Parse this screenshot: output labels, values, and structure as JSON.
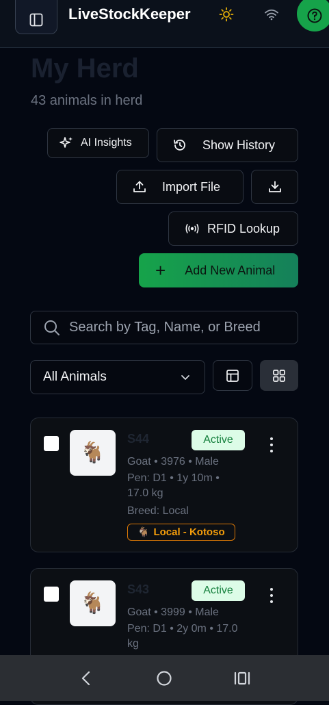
{
  "header": {
    "app_title": "LiveStockKeeper",
    "icons": [
      "sidebar-toggle-icon",
      "sun-icon",
      "wifi-icon",
      "help-icon"
    ]
  },
  "page": {
    "title": "My Herd",
    "subtitle": "43 animals in herd"
  },
  "actions": {
    "ai_insights": "AI Insights",
    "show_history": "Show History",
    "import_file": "Import File",
    "rfid_lookup": "RFID Lookup",
    "add_new_animal": "Add New Animal"
  },
  "search": {
    "placeholder": "Search by Tag, Name, or Breed"
  },
  "filter": {
    "selected": "All Animals"
  },
  "colors": {
    "accent_green": "#16a34a",
    "status_active_bg": "#dcfce7",
    "status_active_text": "#15803d",
    "breed_badge": "#f59e0b"
  },
  "animals": [
    {
      "tag": "S44",
      "status": "Active",
      "line1": "Goat • 3976 • Male",
      "line2": "Pen: D1 • 1y 10m •",
      "line3": "17.0 kg",
      "line4": "Breed: Local",
      "badge": "Local - Kotoso",
      "image_icon": "goat-icon"
    },
    {
      "tag": "S43",
      "status": "Active",
      "line1": "Goat • 3999 • Male",
      "line2": "Pen: D1 • 2y 0m • 17.0",
      "line3": "kg",
      "image_icon": "goat-icon"
    }
  ],
  "system_nav": [
    "back-icon",
    "home-icon",
    "recents-icon"
  ]
}
